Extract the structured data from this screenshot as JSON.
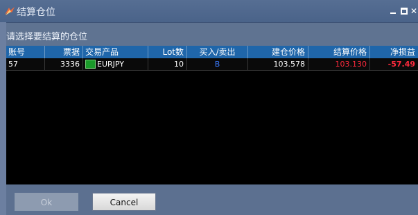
{
  "window": {
    "title": "结算仓位",
    "close_glyph": "✕"
  },
  "prompt": "请选择要结算的仓位",
  "table": {
    "columns": [
      "账号",
      "票据",
      "交易产品",
      "Lot数",
      "买入/卖出",
      "建仓价格",
      "结算价格",
      "净损益"
    ],
    "rows": [
      {
        "account": "57",
        "ticket": "3336",
        "symbol": "EURJPY",
        "lots": "10",
        "side": "B",
        "open_price": "103.578",
        "close_price": "103.130",
        "pnl": "-57.49"
      }
    ]
  },
  "buttons": {
    "ok": "Ok",
    "cancel": "Cancel"
  },
  "colors": {
    "header_bg": "#1f66aa",
    "buy": "#3b7bff",
    "loss": "#ff2a3d",
    "price_close": "#ff2a3d"
  }
}
